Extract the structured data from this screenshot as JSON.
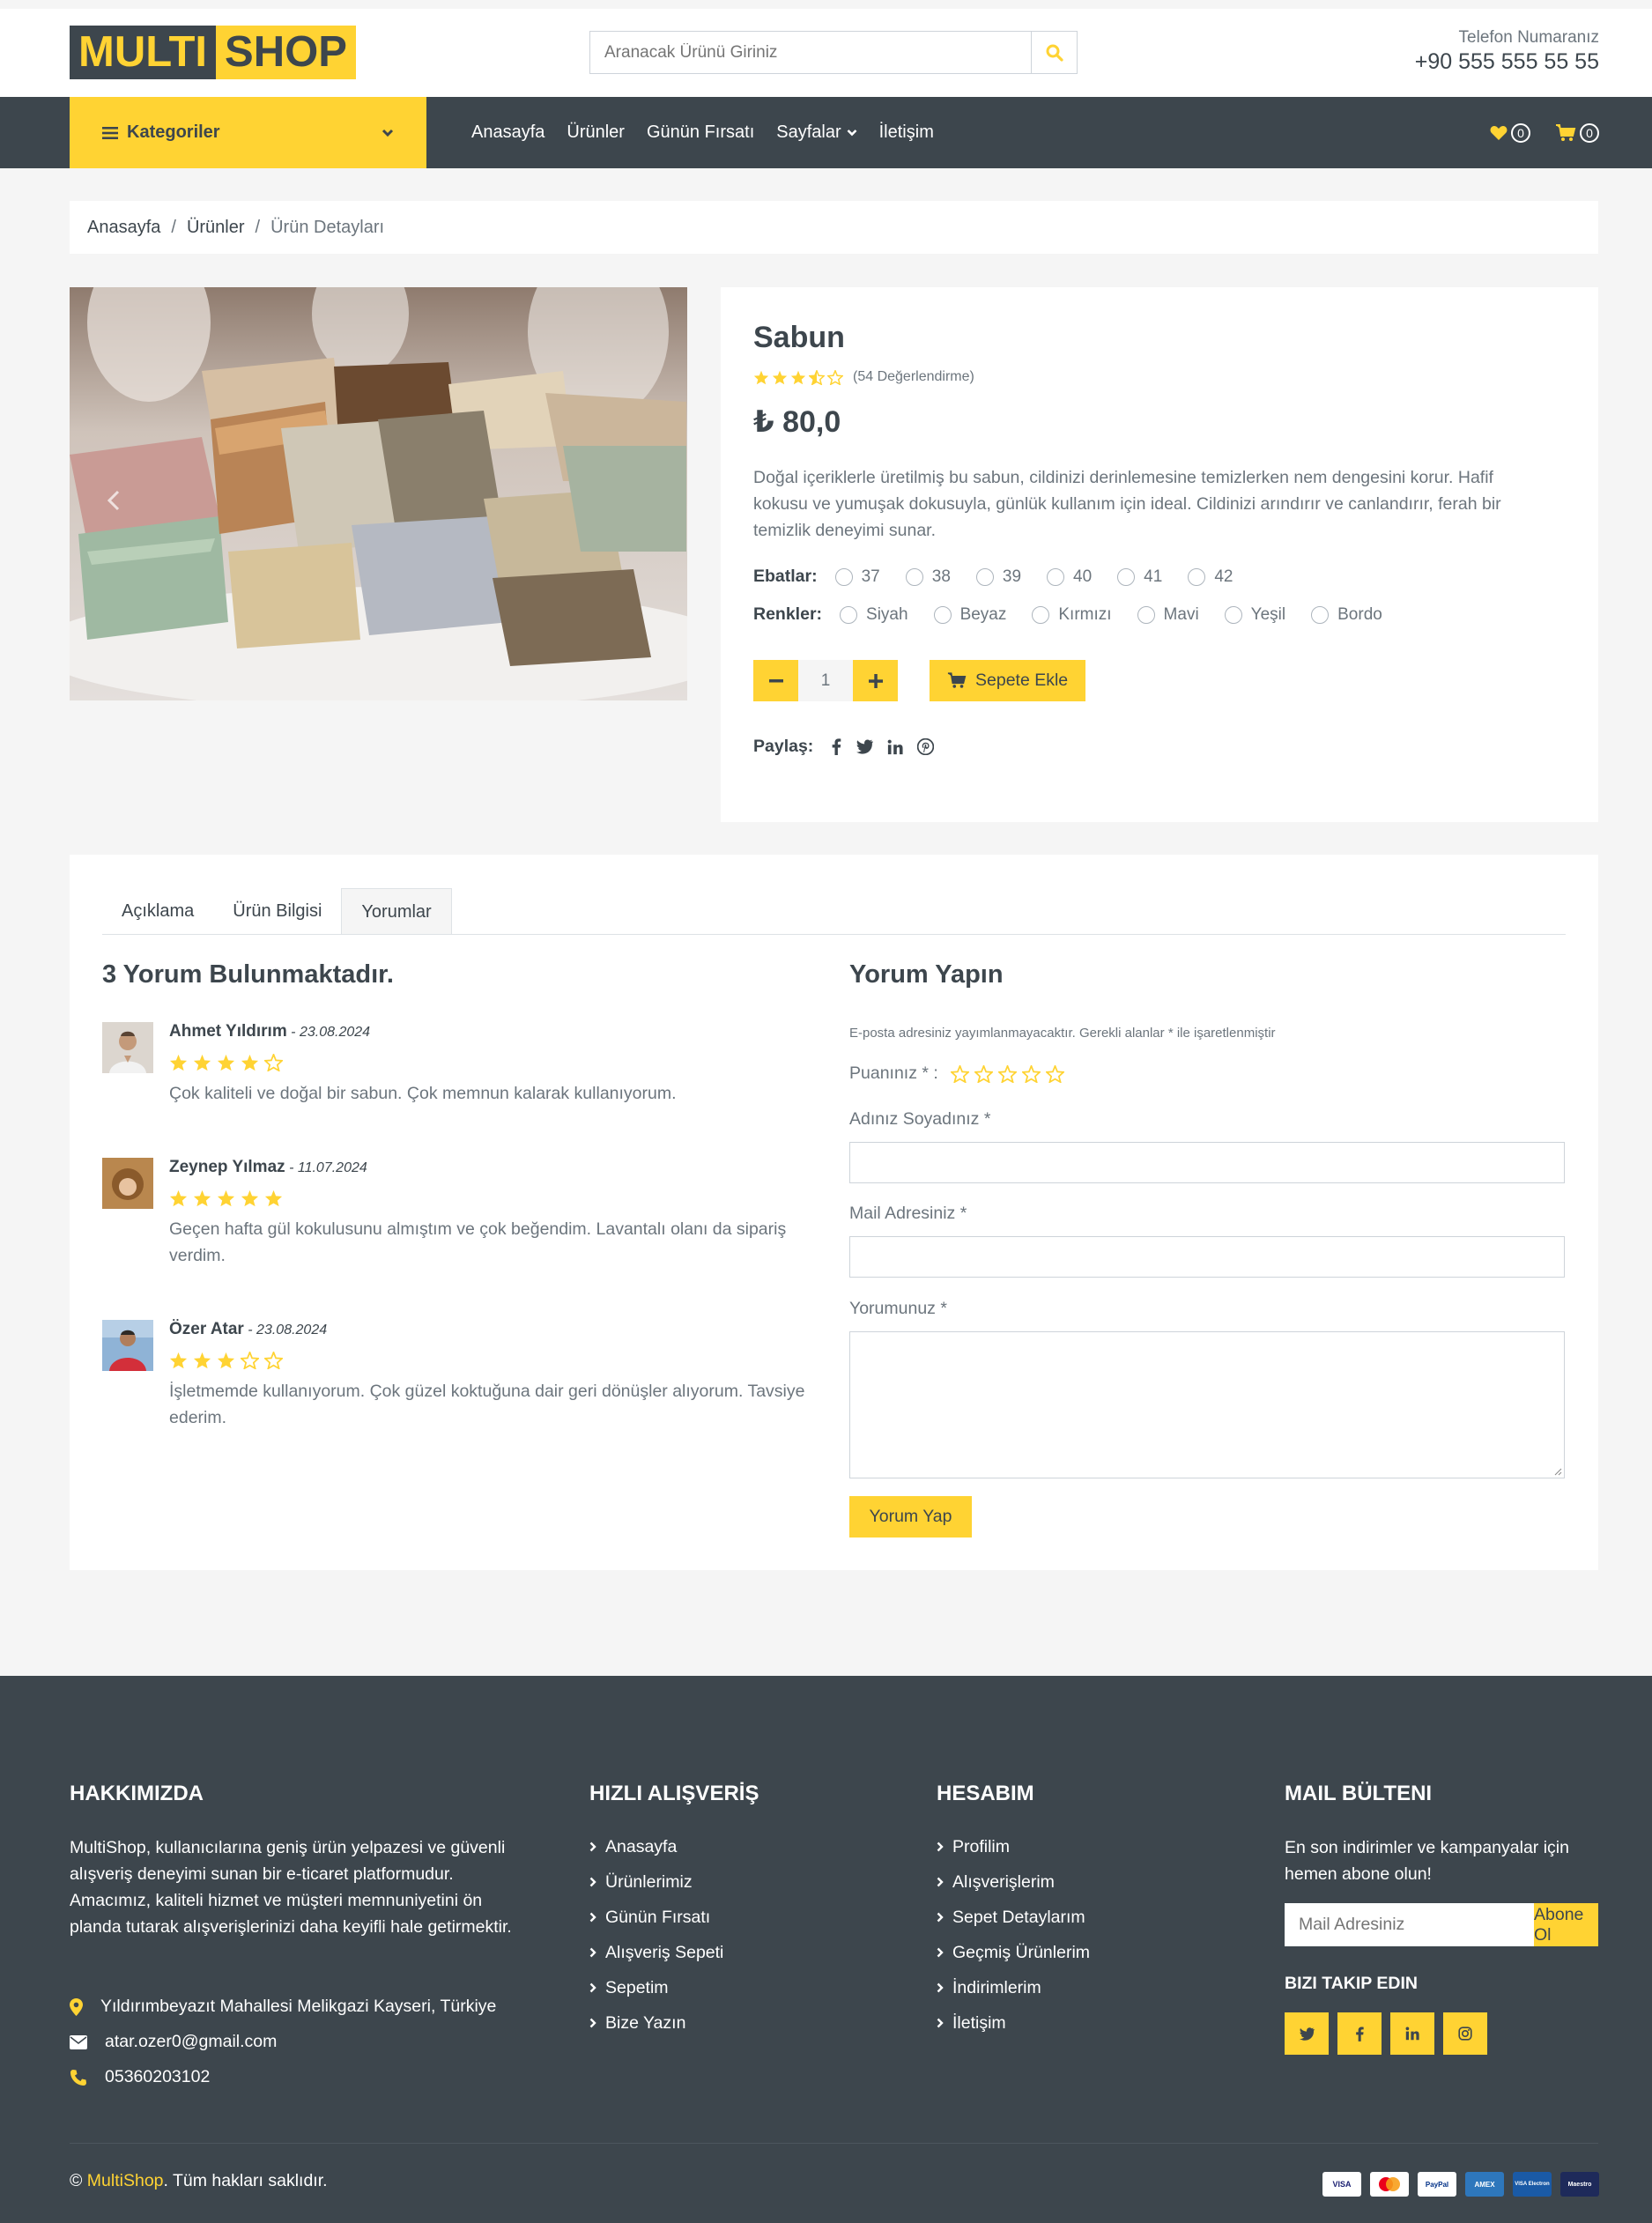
{
  "header": {
    "logo_part1": "MULTI",
    "logo_part2": "SHOP",
    "search_placeholder": "Aranacak Ürünü Giriniz",
    "phone_label": "Telefon Numaranız",
    "phone_number": "+90 555 555 55 55"
  },
  "nav": {
    "categories_label": "Kategoriler",
    "items": [
      "Anasayfa",
      "Ürünler",
      "Günün Fırsatı",
      "Sayfalar",
      "İletişim"
    ],
    "wishlist_count": "0",
    "cart_count": "0"
  },
  "breadcrumb": [
    "Anasayfa",
    "Ürünler",
    "Ürün Detayları"
  ],
  "product": {
    "title": "Sabun",
    "rating": 3.5,
    "rating_count": "(54 Değerlendirme)",
    "price": "₺ 80,0",
    "description": "Doğal içeriklerle üretilmiş bu sabun, cildinizi derinlemesine temizlerken nem dengesini korur. Hafif kokusu ve yumuşak dokusuyla, günlük kullanım için ideal. Cildinizi arındırır ve canlandırır, ferah bir temizlik deneyimi sunar.",
    "sizes_label": "Ebatlar:",
    "sizes": [
      "37",
      "38",
      "39",
      "40",
      "41",
      "42"
    ],
    "colors_label": "Renkler:",
    "colors": [
      "Siyah",
      "Beyaz",
      "Kırmızı",
      "Mavi",
      "Yeşil",
      "Bordo"
    ],
    "quantity": "1",
    "add_to_cart": "Sepete Ekle",
    "share_label": "Paylaş:"
  },
  "tabs": [
    "Açıklama",
    "Ürün Bilgisi",
    "Yorumlar"
  ],
  "reviews": {
    "title": "3 Yorum Bulunmaktadır.",
    "items": [
      {
        "name": "Ahmet Yıldırım",
        "date": " - 23.08.2024",
        "stars": 4,
        "text": "Çok kaliteli ve doğal bir sabun. Çok memnun kalarak kullanıyorum."
      },
      {
        "name": "Zeynep Yılmaz",
        "date": " - 11.07.2024",
        "stars": 5,
        "text": "Geçen hafta gül kokulusunu almıştım ve çok beğendim. Lavantalı olanı da sipariş verdim."
      },
      {
        "name": "Özer Atar",
        "date": " - 23.08.2024",
        "stars": 3,
        "text": "İşletmemde kullanıyorum. Çok güzel koktuğuna dair geri dönüşler alıyorum. Tavsiye ederim."
      }
    ]
  },
  "review_form": {
    "title": "Yorum Yapın",
    "note": "E-posta adresiniz yayımlanmayacaktır. Gerekli alanlar * ile işaretlenmiştir",
    "rating_label": "Puanınız * :",
    "name_label": "Adınız Soyadınız *",
    "email_label": "Mail Adresiniz *",
    "comment_label": "Yorumunuz *",
    "submit": "Yorum Yap"
  },
  "footer": {
    "about_title": "HAKKIMIZDA",
    "about_text": "MultiShop, kullanıcılarına geniş ürün yelpazesi ve güvenli alışveriş deneyimi sunan bir e-ticaret platformudur. Amacımız, kaliteli hizmet ve müşteri memnuniyetini ön planda tutarak alışverişlerinizi daha keyifli hale getirmektir.",
    "address": "Yıldırımbeyazıt Mahallesi Melikgazi Kayseri, Türkiye",
    "email": "atar.ozer0@gmail.com",
    "phone": "05360203102",
    "quick_title": "HIZLI ALIŞVERİŞ",
    "quick_links": [
      "Anasayfa",
      "Ürünlerimiz",
      "Günün Fırsatı",
      "Alışveriş Sepeti",
      "Sepetim",
      "Bize Yazın"
    ],
    "account_title": "HESABIM",
    "account_links": [
      "Profilim",
      "Alışverişlerim",
      "Sepet Detaylarım",
      "Geçmiş Ürünlerim",
      "İndirimlerim",
      "İletişim"
    ],
    "newsletter_title": "MAIL BÜLTENI",
    "newsletter_text": "En son indirimler ve kampanyalar için hemen abone olun!",
    "newsletter_placeholder": "Mail Adresiniz",
    "newsletter_button": "Abone Ol",
    "follow_title": "BIZI TAKIP EDIN",
    "copyright_prefix": "© ",
    "copyright_brand": "MultiShop",
    "copyright_suffix": ". Tüm hakları saklıdır.",
    "payment_cards": [
      "VISA",
      "MC",
      "PayPal",
      "AMEX",
      "VISA Electron",
      "Maestro"
    ]
  },
  "colors": {
    "accent": "#ffd333",
    "dark": "#3d464d",
    "muted": "#6c757d",
    "bg": "#f5f5f5"
  }
}
